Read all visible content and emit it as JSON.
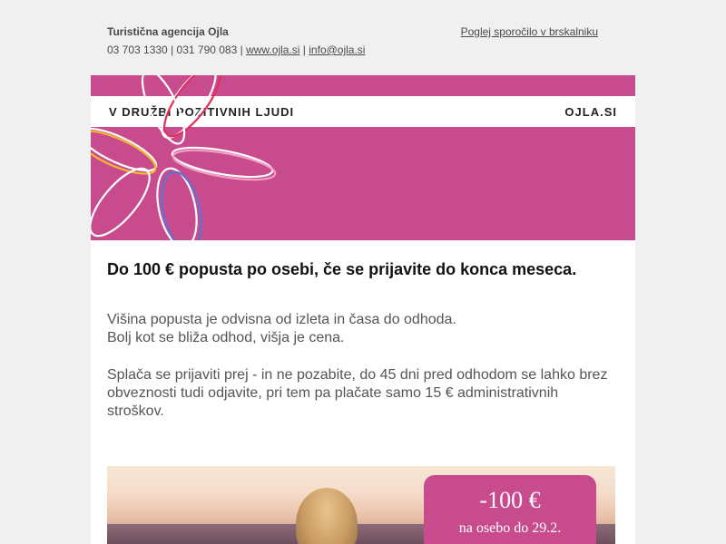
{
  "preheader": {
    "agency_name": "Turistična agencija Ojla",
    "phone1": "03 703 1330",
    "phone2": "031 790 083",
    "website": "www.ojla.si",
    "email": "info@ojla.si",
    "sep": "|",
    "browser_link": "Poglej sporočilo v brskalniku"
  },
  "header": {
    "tagline": "V DRUŽBI POZITIVNIH LJUDI",
    "site_name": "OJLA.SI",
    "brand_color": "#c84b8e",
    "decoration": "flower-logo"
  },
  "content": {
    "headline": "Do 100 € popusta po osebi, če se prijavite do konca meseca.",
    "p1_line1": "Višina popusta je odvisna od izleta in časa do odhoda.",
    "p1_line2": "Bolj kot se bliža odhod, višja je cena.",
    "p2": "Splača se prijaviti prej - in ne pozabite, do 45 dni pred odhodom se lahko brez obveznosti tudi odjavite, pri tem pa plačate samo 15 € administrativnih stroškov."
  },
  "promo": {
    "amount": "-100 €",
    "subtitle": "na osebo do 29.2."
  }
}
